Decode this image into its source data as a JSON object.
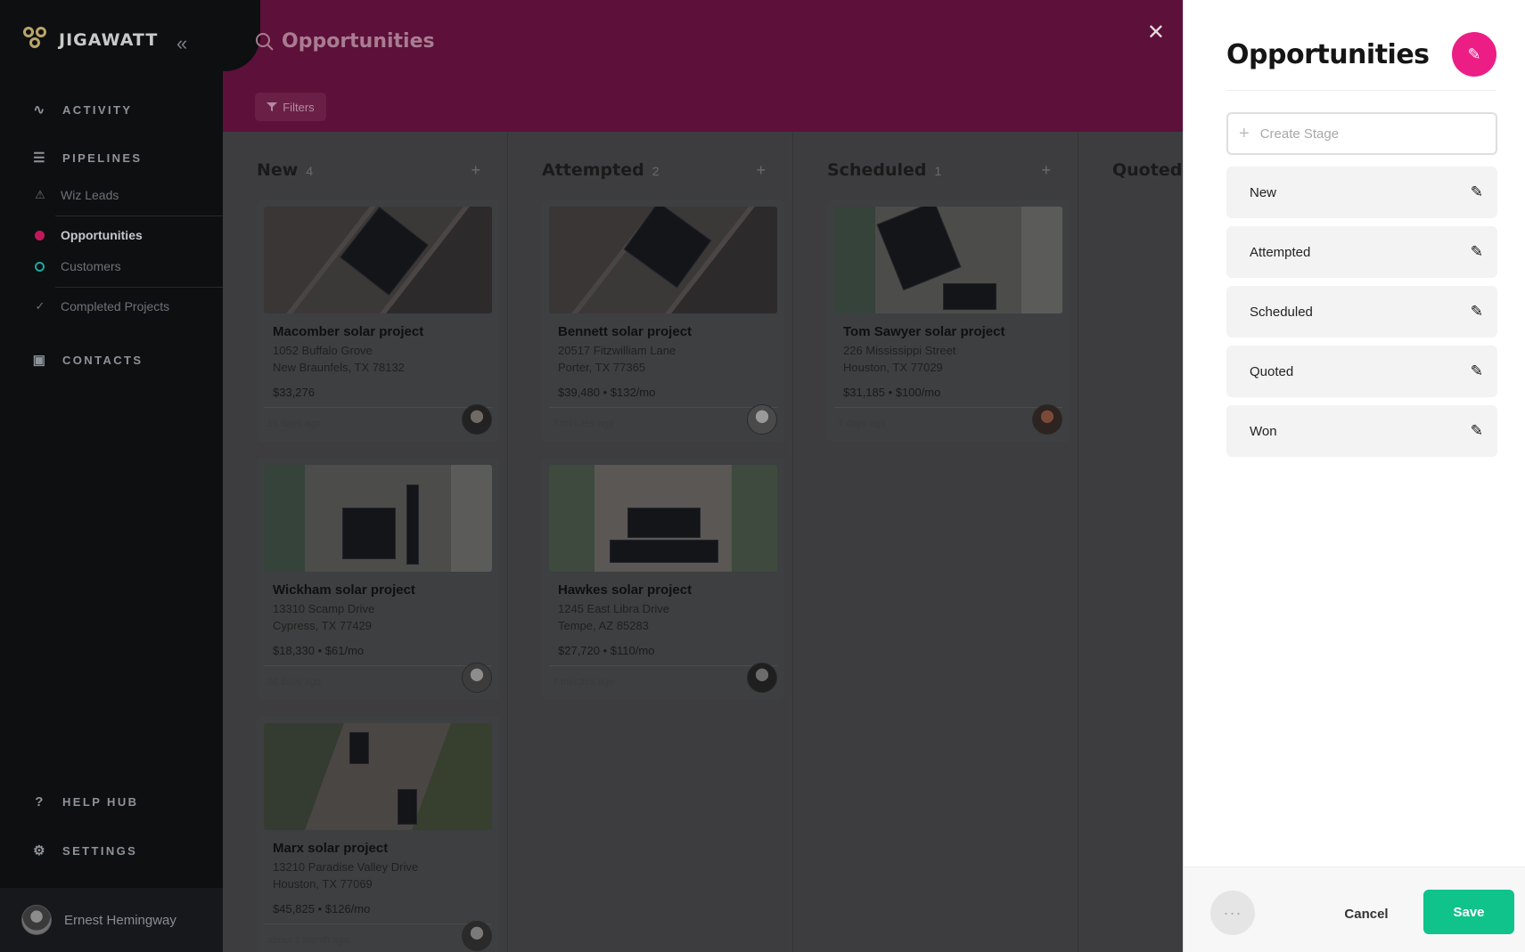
{
  "app": {
    "name": "JIGAWATT",
    "collapse_icon": "double-chevron-left-icon"
  },
  "nav": {
    "activity": "ACTIVITY",
    "pipelines": "PIPELINES",
    "wiz_leads": "Wiz Leads",
    "opportunities": "Opportunities",
    "customers": "Customers",
    "completed_projects": "Completed Projects",
    "contacts": "CONTACTS",
    "help_hub": "HELP HUB",
    "settings": "SETTINGS",
    "colors": {
      "opportunities_dot": "#c2185b",
      "customers_dot": "#1ea7a0"
    }
  },
  "user": {
    "name": "Ernest Hemingway"
  },
  "header": {
    "search_title": "Opportunities",
    "filters_label": "Filters",
    "close_icon": "close-icon"
  },
  "columns": [
    {
      "title": "New",
      "count": "4",
      "add": "+"
    },
    {
      "title": "Attempted",
      "count": "2",
      "add": "+"
    },
    {
      "title": "Scheduled",
      "count": "1",
      "add": "+"
    },
    {
      "title": "Quoted",
      "count": "",
      "add": ""
    }
  ],
  "cards": [
    {
      "name": "Macomber solar project",
      "address1": "1052 Buffalo Grove",
      "address2": "New Braunfels, TX 78132",
      "price": "$33,276",
      "time": "16 days ago"
    },
    {
      "name": "Wickham solar project",
      "address1": "13310 Scamp Drive",
      "address2": "Cypress, TX 77429",
      "price": "$18,330  •  $61/mo",
      "time": "30 days ago"
    },
    {
      "name": "Marx solar project",
      "address1": "13210 Paradise Valley Drive",
      "address2": "Houston, TX 77069",
      "price": "$45,825  •  $126/mo",
      "time": "about 1 month ago"
    },
    {
      "name": "Bennett solar project",
      "address1": "20517 Fitzwilliam Lane",
      "address2": "Porter, TX 77365",
      "price": "$39,480  •  $132/mo",
      "time": "7 minutes ago"
    },
    {
      "name": "Hawkes solar project",
      "address1": "1245 East Libra Drive",
      "address2": "Tempe, AZ 85283",
      "price": "$27,720  •  $110/mo",
      "time": "7 minutes ago"
    },
    {
      "name": "Tom Sawyer solar project",
      "address1": "226 Mississippi Street",
      "address2": "Houston, TX 77029",
      "price": "$31,185  •  $100/mo",
      "time": "7 days ago"
    }
  ],
  "panel": {
    "title": "Opportunities",
    "create_placeholder": "Create Stage",
    "stages": [
      "New",
      "Attempted",
      "Scheduled",
      "Quoted",
      "Won"
    ],
    "more_label": "···",
    "cancel_label": "Cancel",
    "save_label": "Save",
    "colors": {
      "accent": "#ec1e85",
      "save": "#10c38a",
      "header": "#5d1039"
    }
  }
}
